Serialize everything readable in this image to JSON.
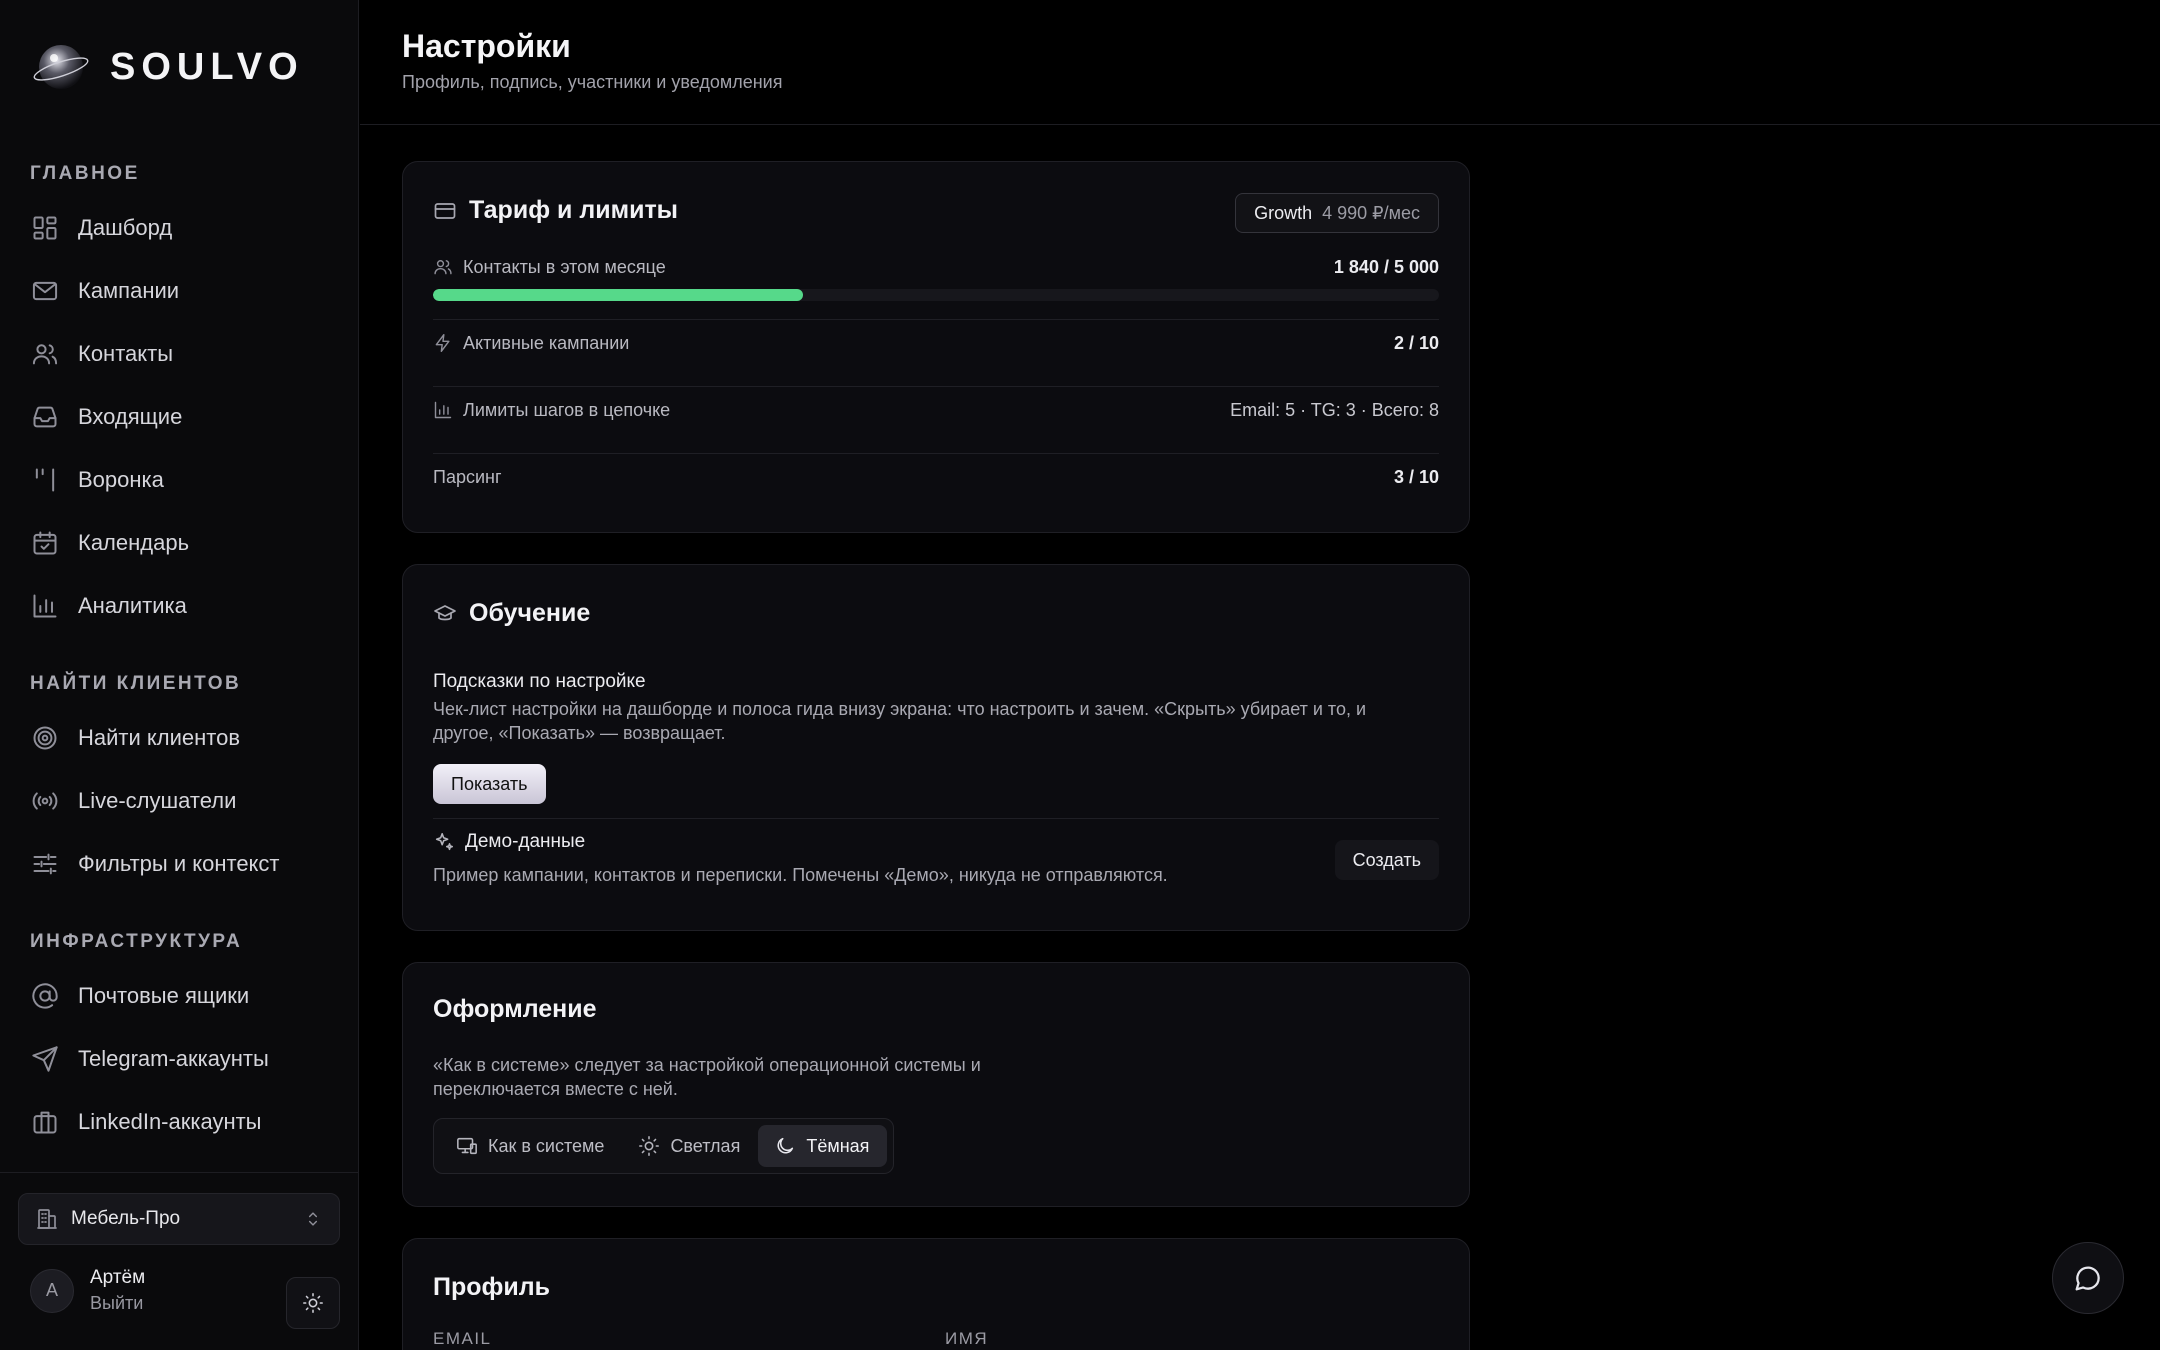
{
  "brand": {
    "name": "SOULVO"
  },
  "sidebar": {
    "sections": [
      {
        "title": "ГЛАВНОЕ"
      },
      {
        "title": "НАЙТИ КЛИЕНТОВ"
      },
      {
        "title": "ИНФРАСТРУКТУРА"
      }
    ],
    "items": [
      {
        "label": "Дашборд",
        "icon": "dashboard-icon"
      },
      {
        "label": "Кампании",
        "icon": "mail-icon"
      },
      {
        "label": "Контакты",
        "icon": "users-icon"
      },
      {
        "label": "Входящие",
        "icon": "inbox-icon"
      },
      {
        "label": "Воронка",
        "icon": "funnel-icon"
      },
      {
        "label": "Календарь",
        "icon": "calendar-icon"
      },
      {
        "label": "Аналитика",
        "icon": "bar-chart-icon"
      },
      {
        "label": "Найти клиентов",
        "icon": "target-icon"
      },
      {
        "label": "Live-слушатели",
        "icon": "broadcast-icon"
      },
      {
        "label": "Фильтры и контекст",
        "icon": "sliders-icon"
      },
      {
        "label": "Почтовые ящики",
        "icon": "at-sign-icon"
      },
      {
        "label": "Telegram-аккаунты",
        "icon": "send-icon"
      },
      {
        "label": "LinkedIn-аккаунты",
        "icon": "briefcase-icon"
      }
    ],
    "workspace": {
      "label": "Мебель-Про"
    },
    "user": {
      "initial": "А",
      "name": "Артём",
      "logout": "Выйти"
    }
  },
  "header": {
    "title": "Настройки",
    "subtitle": "Профиль, подпись, участники и уведомления"
  },
  "plan": {
    "title": "Тариф и лимиты",
    "badge_name": "Growth",
    "badge_price": "4 990 ₽/мес",
    "contacts": {
      "label": "Контакты в этом месяце",
      "value": "1 840 / 5 000",
      "fraction": 0.368,
      "color": "#56d98a"
    },
    "campaigns": {
      "label": "Активные кампании",
      "value": "2 / 10"
    },
    "steps": {
      "label": "Лимиты шагов в цепочке",
      "value": "Email: 5 · TG: 3 · Всего: 8"
    },
    "parsing": {
      "label": "Парсинг",
      "value": "3 / 10"
    }
  },
  "learning": {
    "title": "Обучение",
    "hints_title": "Подсказки по настройке",
    "hints_desc_1": "Чек-лист настройки на дашборде и полоса гида внизу экрана: что настроить и зачем. «Скрыть» убирает и то, и",
    "hints_desc_2": "другое, «Показать» — возвращает.",
    "show_button": "Показать",
    "demo_title": "Демо-данные",
    "demo_desc": "Пример кампании, контактов и переписки. Помечены «Демо», никуда не отправляются.",
    "create_button": "Создать"
  },
  "appearance": {
    "title": "Оформление",
    "desc_1": "«Как в системе» следует за настройкой операционной системы и",
    "desc_2": "переключается вместе с ней.",
    "options": [
      {
        "label": "Как в системе",
        "icon": "monitor-icon"
      },
      {
        "label": "Светлая",
        "icon": "sun-icon"
      },
      {
        "label": "Тёмная",
        "icon": "moon-icon",
        "active": true
      }
    ]
  },
  "profile": {
    "title": "Профиль",
    "email_label": "EMAIL",
    "name_label": "ИМЯ"
  }
}
